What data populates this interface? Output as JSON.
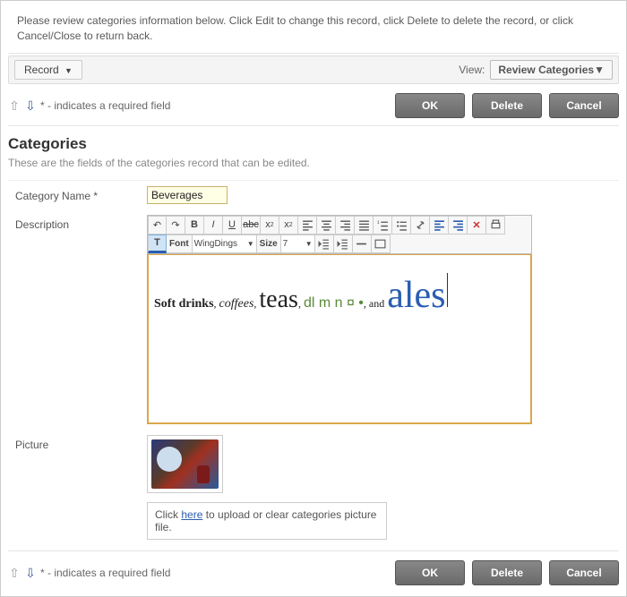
{
  "instructions": "Please review categories information below. Click Edit to change this record, click Delete to delete the record, or click Cancel/Close to return back.",
  "toolbar": {
    "record_label": "Record",
    "view_label": "View:",
    "view_selected": "Review Categories"
  },
  "required_note": "* - indicates a required field",
  "buttons": {
    "ok": "OK",
    "delete": "Delete",
    "cancel": "Cancel"
  },
  "section": {
    "title": "Categories",
    "subtitle": "These are the fields of the categories record that can be edited."
  },
  "fields": {
    "category_name": {
      "label": "Category Name *",
      "value": "Beverages"
    },
    "description": {
      "label": "Description",
      "content": {
        "w1": "Soft drinks",
        "sep1": ", ",
        "w2": "coffees",
        "sep2": ", ",
        "w3": "teas",
        "sep3": ", ",
        "w4": "dl m n ¤ •",
        "sep4": ", and ",
        "w5": "ales"
      }
    },
    "picture": {
      "label": "Picture",
      "upload_prefix": "Click ",
      "upload_link": "here",
      "upload_suffix": " to upload or clear categories picture file."
    }
  },
  "rte": {
    "font_label": "Font",
    "font_value": "WingDings",
    "size_label": "Size",
    "size_value": "7"
  }
}
